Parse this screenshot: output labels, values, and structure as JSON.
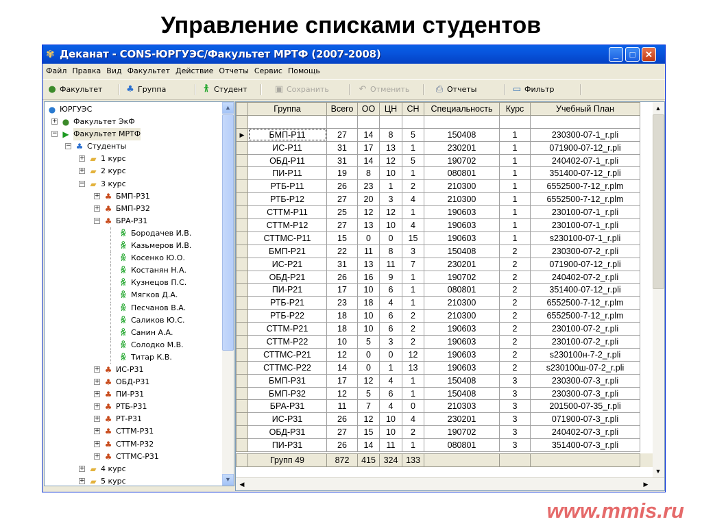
{
  "slide": {
    "title": "Управление списками студентов",
    "footer_url": "www.mmis.ru"
  },
  "window": {
    "title": "Деканат - CONS-ЮРГУЭС/Факультет МРТФ (2007-2008)",
    "controls": {
      "minimize": "_",
      "maximize": "□",
      "close": "✕"
    }
  },
  "menu": [
    "Файл",
    "Правка",
    "Вид",
    "Факультет",
    "Действие",
    "Отчеты",
    "Сервис",
    "Помощь"
  ],
  "toolbar": {
    "faculty": "Факультет",
    "group": "Группа",
    "student": "Студент",
    "save": "Сохранить",
    "cancel": "Отменить",
    "reports": "Отчеты",
    "filter": "Фильтр"
  },
  "tree": {
    "root": "ЮРГУЭС",
    "faculty_ekf": "Факультет ЭкФ",
    "faculty_mrtf": "Факультет МРТФ",
    "students": "Студенты",
    "courses": [
      "1 курс",
      "2 курс",
      "3 курс",
      "4 курс",
      "5 курс"
    ],
    "course3_groups_before": [
      "БМП-Р31",
      "БМП-Р32"
    ],
    "open_group": "БРА-Р31",
    "students_list": [
      "Бородачев И.В.",
      "Казьмеров И.В.",
      "Косенко Ю.О.",
      "Костанян Н.А.",
      "Кузнецов П.С.",
      "Мягков Д.А.",
      "Песчанов В.А.",
      "Саликов Ю.С.",
      "Санин А.А.",
      "Солодко М.В.",
      "Титар К.В."
    ],
    "course3_groups_after": [
      "ИС-Р31",
      "ОБД-Р31",
      "ПИ-Р31",
      "РТБ-Р31",
      "РТ-Р31",
      "СТТМ-Р31",
      "СТТМ-Р32",
      "СТТМС-Р31"
    ]
  },
  "grid": {
    "headers": [
      "Группа",
      "Всего",
      "ОО",
      "ЦН",
      "СН",
      "Специальность",
      "Курс",
      "Учебный План"
    ],
    "rows": [
      [
        "БМП-Р11",
        "27",
        "14",
        "8",
        "5",
        "150408",
        "1",
        "230300-07-1_r.pli"
      ],
      [
        "ИС-Р11",
        "31",
        "17",
        "13",
        "1",
        "230201",
        "1",
        "071900-07-12_r.pli"
      ],
      [
        "ОБД-Р11",
        "31",
        "14",
        "12",
        "5",
        "190702",
        "1",
        "240402-07-1_r.pli"
      ],
      [
        "ПИ-Р11",
        "19",
        "8",
        "10",
        "1",
        "080801",
        "1",
        "351400-07-12_r.pli"
      ],
      [
        "РТБ-Р11",
        "26",
        "23",
        "1",
        "2",
        "210300",
        "1",
        "6552500-7-12_r.plm"
      ],
      [
        "РТБ-Р12",
        "27",
        "20",
        "3",
        "4",
        "210300",
        "1",
        "6552500-7-12_r.plm"
      ],
      [
        "СТТМ-Р11",
        "25",
        "12",
        "12",
        "1",
        "190603",
        "1",
        "230100-07-1_r.pli"
      ],
      [
        "СТТМ-Р12",
        "27",
        "13",
        "10",
        "4",
        "190603",
        "1",
        "230100-07-1_r.pli"
      ],
      [
        "СТТМС-Р11",
        "15",
        "0",
        "0",
        "15",
        "190603",
        "1",
        "s230100-07-1_r.pli"
      ],
      [
        "БМП-Р21",
        "22",
        "11",
        "8",
        "3",
        "150408",
        "2",
        "230300-07-2_r.pli"
      ],
      [
        "ИС-Р21",
        "31",
        "13",
        "11",
        "7",
        "230201",
        "2",
        "071900-07-12_r.pli"
      ],
      [
        "ОБД-Р21",
        "26",
        "16",
        "9",
        "1",
        "190702",
        "2",
        "240402-07-2_r.pli"
      ],
      [
        "ПИ-Р21",
        "17",
        "10",
        "6",
        "1",
        "080801",
        "2",
        "351400-07-12_r.pli"
      ],
      [
        "РТБ-Р21",
        "23",
        "18",
        "4",
        "1",
        "210300",
        "2",
        "6552500-7-12_r.plm"
      ],
      [
        "РТБ-Р22",
        "18",
        "10",
        "6",
        "2",
        "210300",
        "2",
        "6552500-7-12_r.plm"
      ],
      [
        "СТТМ-Р21",
        "18",
        "10",
        "6",
        "2",
        "190603",
        "2",
        "230100-07-2_r.pli"
      ],
      [
        "СТТМ-Р22",
        "10",
        "5",
        "3",
        "2",
        "190603",
        "2",
        "230100-07-2_r.pli"
      ],
      [
        "СТТМС-Р21",
        "12",
        "0",
        "0",
        "12",
        "190603",
        "2",
        "s230100н-7-2_r.pli"
      ],
      [
        "СТТМС-Р22",
        "14",
        "0",
        "1",
        "13",
        "190603",
        "2",
        "s230100ш-07-2_r.pli"
      ],
      [
        "БМП-Р31",
        "17",
        "12",
        "4",
        "1",
        "150408",
        "3",
        "230300-07-3_r.pli"
      ],
      [
        "БМП-Р32",
        "12",
        "5",
        "6",
        "1",
        "150408",
        "3",
        "230300-07-3_r.pli"
      ],
      [
        "БРА-Р31",
        "11",
        "7",
        "4",
        "0",
        "210303",
        "3",
        "201500-07-35_r.pli"
      ],
      [
        "ИС-Р31",
        "26",
        "12",
        "10",
        "4",
        "230201",
        "3",
        "071900-07-3_r.pli"
      ],
      [
        "ОБД-Р31",
        "27",
        "15",
        "10",
        "2",
        "190702",
        "3",
        "240402-07-3_r.pli"
      ],
      [
        "ПИ-Р31",
        "26",
        "14",
        "11",
        "1",
        "080801",
        "3",
        "351400-07-3_r.pli"
      ]
    ],
    "totals": [
      "Групп 49",
      "872",
      "415",
      "324",
      "133"
    ]
  },
  "colors": {
    "titlebar": "#0a5fe4",
    "footer_url": "#e56a6a",
    "student_icon": "#1fa52a"
  }
}
